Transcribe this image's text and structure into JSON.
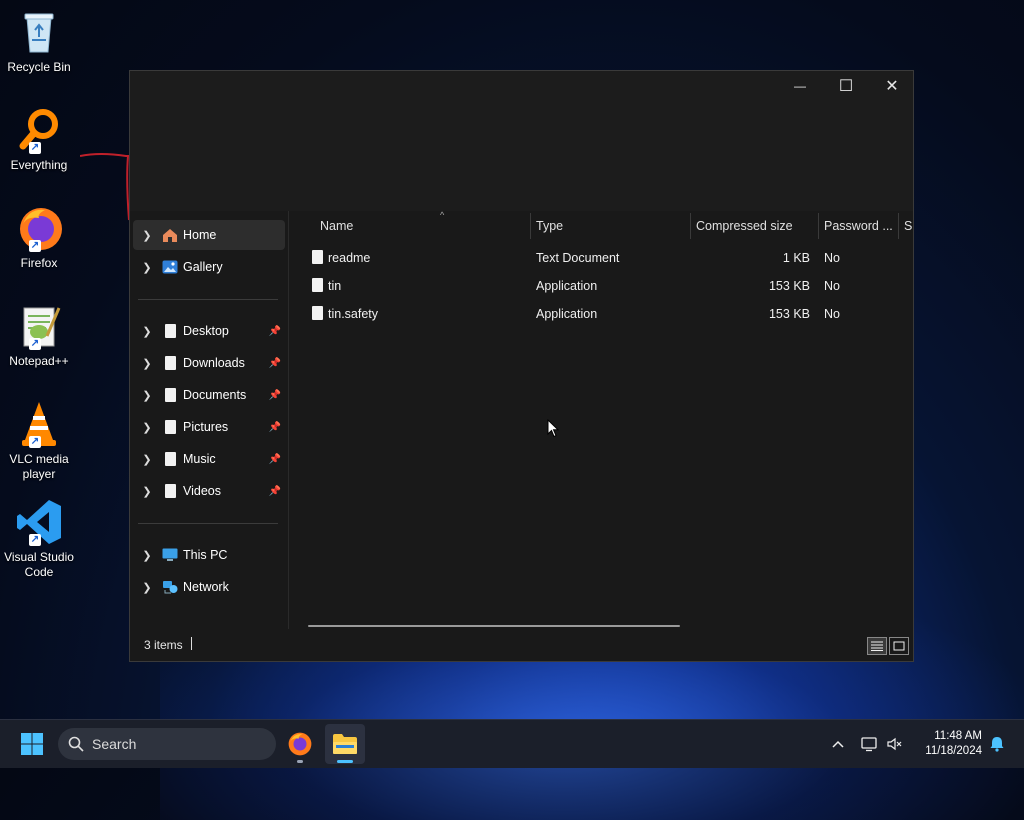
{
  "desktop": {
    "icons": [
      {
        "label": "Recycle Bin",
        "icon": "recycle-bin-icon"
      },
      {
        "label": "Everything",
        "icon": "everything-search-icon"
      },
      {
        "label": "Firefox",
        "icon": "firefox-icon"
      },
      {
        "label": "Notepad++",
        "icon": "notepadpp-icon"
      },
      {
        "label": "VLC media player",
        "icon": "vlc-icon"
      },
      {
        "label": "Visual Studio Code",
        "icon": "vscode-icon"
      }
    ]
  },
  "window": {
    "controls": {
      "minimize": "—",
      "maximize": "☐",
      "close": "✕"
    },
    "nav": {
      "home": "Home",
      "gallery": "Gallery",
      "pinned": [
        "Desktop",
        "Downloads",
        "Documents",
        "Pictures",
        "Music",
        "Videos"
      ],
      "this_pc": "This PC",
      "network": "Network"
    },
    "columns": [
      "Name",
      "Type",
      "Compressed size",
      "Password ...",
      "Si"
    ],
    "files": [
      {
        "name": "readme",
        "type": "Text Document",
        "size": "1 KB",
        "password": "No"
      },
      {
        "name": "tin",
        "type": "Application",
        "size": "153 KB",
        "password": "No"
      },
      {
        "name": "tin.safety",
        "type": "Application",
        "size": "153 KB",
        "password": "No"
      }
    ],
    "status": {
      "items": "3 items"
    }
  },
  "taskbar": {
    "search_placeholder": "Search",
    "clock": {
      "time": "11:48 AM",
      "date": "11/18/2024"
    }
  },
  "colors": {
    "accent": "#0078d4",
    "window_bg": "#191919",
    "selected": "#2d2d2d"
  }
}
